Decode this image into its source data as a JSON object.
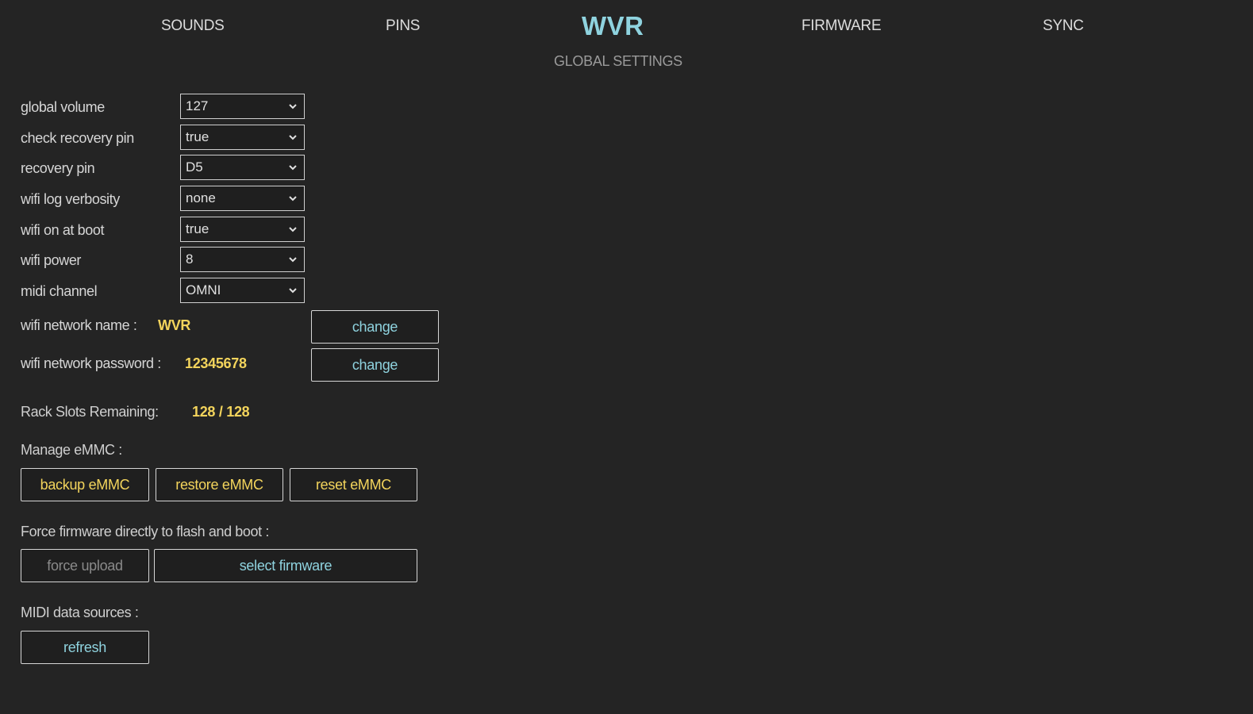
{
  "nav": {
    "sounds": "SOUNDS",
    "pins": "PINS",
    "brand": "WVR",
    "firmware": "FIRMWARE",
    "sync": "SYNC"
  },
  "subtitle": "GLOBAL SETTINGS",
  "settings": [
    {
      "label": "global volume",
      "value": "127"
    },
    {
      "label": "check recovery pin",
      "value": "true"
    },
    {
      "label": "recovery pin",
      "value": "D5"
    },
    {
      "label": "wifi log verbosity",
      "value": "none"
    },
    {
      "label": "wifi on at boot",
      "value": "true"
    },
    {
      "label": "wifi power",
      "value": "8"
    },
    {
      "label": "midi channel",
      "value": "OMNI"
    }
  ],
  "wifi": {
    "name_label": "wifi network name :",
    "name_value": "WVR",
    "password_label": "wifi network password :",
    "password_value": "12345678",
    "change_label": "change"
  },
  "rack": {
    "label": "Rack Slots Remaining:",
    "value": "128 / 128"
  },
  "emmc": {
    "label": "Manage eMMC :",
    "backup": "backup eMMC",
    "restore": "restore eMMC",
    "reset": "reset eMMC"
  },
  "firmware_force": {
    "label": "Force firmware directly to flash and boot :",
    "force_upload": "force upload",
    "select_firmware": "select firmware"
  },
  "midi": {
    "label": "MIDI data sources :",
    "refresh": "refresh"
  },
  "colors": {
    "background": "#242424",
    "accent_cyan": "#8fd3df",
    "accent_yellow": "#f3d45c"
  }
}
